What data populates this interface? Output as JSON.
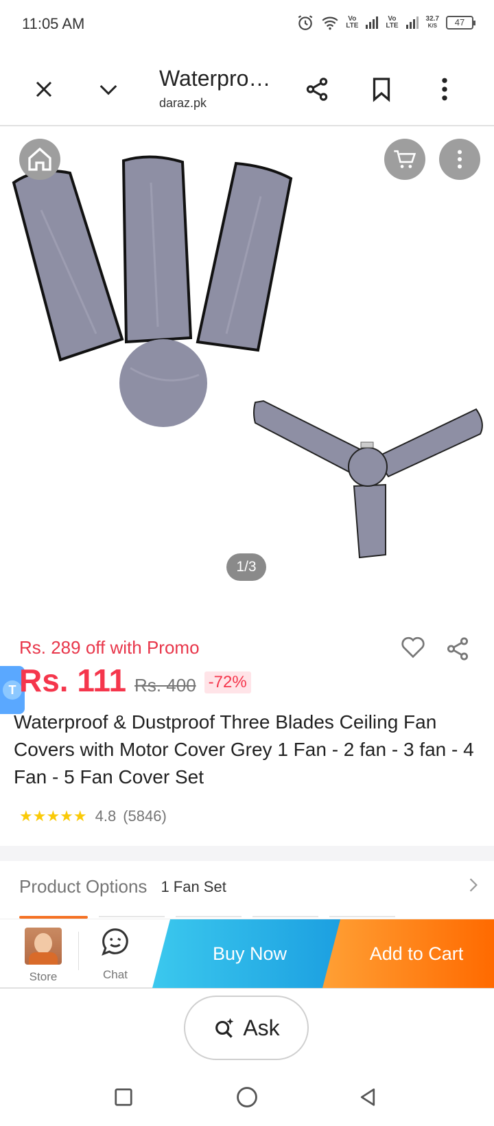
{
  "status_bar": {
    "time": "11:05 AM",
    "net1": "Vo\nLTE",
    "net2": "Vo\nLTE",
    "speed": "32.7",
    "speed_unit": "K/S",
    "battery": "47"
  },
  "browser": {
    "title": "Waterpro…",
    "domain": "daraz.pk",
    "icons": [
      "close-icon",
      "chevron-down-icon",
      "share-icon",
      "bookmark-icon",
      "more-vert-icon"
    ]
  },
  "gallery": {
    "counter": "1/3",
    "overlay_icons": [
      "home-icon",
      "cart-icon",
      "more-vert-icon"
    ]
  },
  "product": {
    "promo": "Rs. 289 off with Promo",
    "price": "Rs. 111",
    "original_price": "Rs. 400",
    "discount": "-72%",
    "title": "Waterproof & Dustproof Three Blades Ceiling Fan Covers with Motor Cover Grey 1 Fan - 2 fan - 3 fan - 4 Fan - 5 Fan Cover Set",
    "stars": "★★★★★",
    "rating": "4.8",
    "reviews": "(5846)",
    "float_badge": "T"
  },
  "options": {
    "label": "Product Options",
    "value": "1 Fan Set"
  },
  "actions": {
    "store": "Store",
    "chat": "Chat",
    "buy_now": "Buy Now",
    "add_to_cart": "Add to Cart"
  },
  "ask": {
    "label": "Ask"
  },
  "colors": {
    "price": "#f5364c",
    "buy_now": "#1b9ee0",
    "add_to_cart": "#ff6a00",
    "star": "#faca08"
  }
}
